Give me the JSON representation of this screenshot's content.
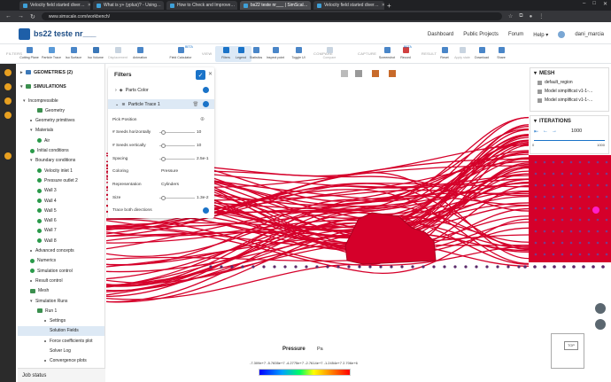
{
  "browser": {
    "tabs": [
      {
        "title": "Velocity field started diver…",
        "active": false
      },
      {
        "title": "What is y+ (yplus)? - Using…",
        "active": false
      },
      {
        "title": "How to Check and Improve…",
        "active": false
      },
      {
        "title": "bs22 teste nr___ | SimScal…",
        "active": true
      },
      {
        "title": "Velocity field started diver…",
        "active": false
      }
    ],
    "url": "www.simscale.com/workbench/"
  },
  "header": {
    "project_title": "bs22 teste nr___",
    "menu": [
      "Dashboard",
      "Public Projects",
      "Forum",
      "Help ▾",
      "dani_marcia"
    ]
  },
  "toolbar": {
    "groups": {
      "filters": "FILTERS",
      "view": "VIEW",
      "compare": "COMPARE",
      "capture": "CAPTURE",
      "result": "RESULT"
    },
    "buttons": [
      {
        "label": "Cutting Plane",
        "dim": false
      },
      {
        "label": "Particle Trace",
        "dim": false
      },
      {
        "label": "Iso Surface",
        "dim": false
      },
      {
        "label": "Iso Volume",
        "dim": false
      },
      {
        "label": "Displacement",
        "dim": true
      },
      {
        "label": "Animation",
        "dim": false
      },
      {
        "label": "Field Calculator",
        "dim": false
      },
      {
        "label": "Filters",
        "dim": false
      },
      {
        "label": "Legend",
        "dim": false
      },
      {
        "label": "Statistics",
        "dim": false
      },
      {
        "label": "Inspect point",
        "dim": false
      },
      {
        "label": "Toggle UI",
        "dim": false
      },
      {
        "label": "Compare",
        "dim": true
      },
      {
        "label": "Screenshot",
        "dim": false
      },
      {
        "label": "Record",
        "dim": false
      },
      {
        "label": "Reset",
        "dim": false
      },
      {
        "label": "Apply state",
        "dim": true
      },
      {
        "label": "Download",
        "dim": false
      },
      {
        "label": "Share",
        "dim": false
      }
    ],
    "beta": "BETA"
  },
  "tree": {
    "geometries": "GEOMETRIES (2)",
    "simulations": "SIMULATIONS",
    "items": [
      {
        "label": "Incompressible",
        "indent": 0,
        "mark": "caret"
      },
      {
        "label": "Geometry",
        "indent": 2,
        "mark": "node"
      },
      {
        "label": "Geometry primitives",
        "indent": 1,
        "mark": "bullet"
      },
      {
        "label": "Materials",
        "indent": 1,
        "mark": "caret"
      },
      {
        "label": "Air",
        "indent": 2,
        "mark": "check"
      },
      {
        "label": "Initial conditions",
        "indent": 1,
        "mark": "check"
      },
      {
        "label": "Boundary conditions",
        "indent": 1,
        "mark": "caret"
      },
      {
        "label": "Velocity inlet 1",
        "indent": 2,
        "mark": "check"
      },
      {
        "label": "Pressure outlet 2",
        "indent": 2,
        "mark": "check"
      },
      {
        "label": "Wall 3",
        "indent": 2,
        "mark": "check"
      },
      {
        "label": "Wall 4",
        "indent": 2,
        "mark": "check"
      },
      {
        "label": "Wall 5",
        "indent": 2,
        "mark": "check"
      },
      {
        "label": "Wall 6",
        "indent": 2,
        "mark": "check"
      },
      {
        "label": "Wall 7",
        "indent": 2,
        "mark": "check"
      },
      {
        "label": "Wall 8",
        "indent": 2,
        "mark": "check"
      },
      {
        "label": "Advanced concepts",
        "indent": 1,
        "mark": "bullet"
      },
      {
        "label": "Numerics",
        "indent": 1,
        "mark": "check"
      },
      {
        "label": "Simulation control",
        "indent": 1,
        "mark": "check"
      },
      {
        "label": "Result control",
        "indent": 1,
        "mark": "bullet"
      },
      {
        "label": "Mesh",
        "indent": 1,
        "mark": "node"
      },
      {
        "label": "Simulation Runs",
        "indent": 1,
        "mark": "caret"
      },
      {
        "label": "Run 1",
        "indent": 2,
        "mark": "node"
      },
      {
        "label": "Settings",
        "indent": 3,
        "mark": "bullet"
      },
      {
        "label": "Solution Fields",
        "indent": 3,
        "mark": "none"
      },
      {
        "label": "Force coefficients plot",
        "indent": 3,
        "mark": "bullet"
      },
      {
        "label": "Solver Log",
        "indent": 3,
        "mark": "none"
      },
      {
        "label": "Convergence plots",
        "indent": 3,
        "mark": "bullet"
      }
    ],
    "highlighted": "Solution Fields",
    "job_status": "Job status"
  },
  "filters_panel": {
    "title": "Filters",
    "parts_color": "Parts Color",
    "particle_trace": "Particle Trace 1",
    "pick_position": "Pick Position",
    "seeds_horizontal_label": "# Seeds horizontally",
    "seeds_horizontal_value": "10",
    "seeds_vertical_label": "# Seeds vertically",
    "seeds_vertical_value": "10",
    "spacing_label": "Spacing",
    "spacing_value": "2.5e-1",
    "coloring_label": "Coloring",
    "coloring_value": "Pressure",
    "representation_label": "Representation",
    "representation_value": "Cylinders",
    "size_label": "Size",
    "size_value": "1.3e-2",
    "trace_both_label": "Trace both directions"
  },
  "mesh_panel": {
    "title": "MESH",
    "items": [
      "default_region",
      "Model simplificat v1-1-…",
      "Model simplificat v1-1-…"
    ]
  },
  "iterations_panel": {
    "title": "ITERATIONS",
    "value": "1000",
    "min": "0",
    "max": "1000"
  },
  "legend": {
    "title": "Pressure",
    "unit": "Pa",
    "ticks": "-7.309e+7  -5.7835e+7 -4.2775e+7 -2.7614e+7 -1.2454e+7  2.706e+6"
  },
  "colors": {
    "accent": "#1a73c8",
    "trace_red": "#d5002a",
    "pink_marker": "#ff1ec8"
  }
}
